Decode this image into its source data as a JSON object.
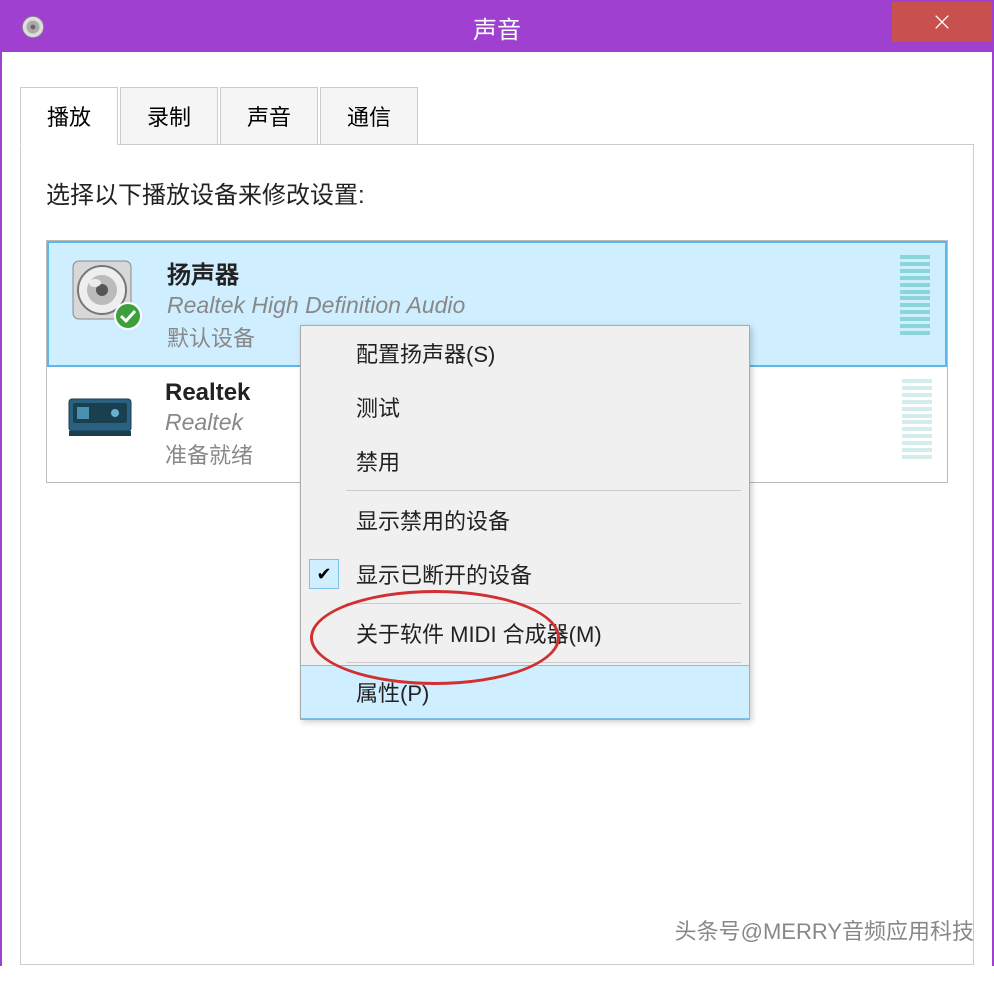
{
  "window": {
    "title": "声音"
  },
  "tabs": [
    {
      "label": "播放",
      "active": true
    },
    {
      "label": "录制",
      "active": false
    },
    {
      "label": "声音",
      "active": false
    },
    {
      "label": "通信",
      "active": false
    }
  ],
  "instruction": "选择以下播放设备来修改设置:",
  "devices": [
    {
      "name": "扬声器",
      "subtitle": "Realtek High Definition Audio",
      "status": "默认设备",
      "selected": true,
      "default": true,
      "icon": "speaker"
    },
    {
      "name": "Realtek",
      "subtitle": "Realtek",
      "status": "准备就绪",
      "selected": false,
      "default": false,
      "icon": "digital"
    }
  ],
  "context_menu": {
    "items": [
      {
        "label": "配置扬声器(S)",
        "checked": false
      },
      {
        "label": "测试",
        "checked": false
      },
      {
        "label": "禁用",
        "checked": false
      },
      {
        "divider": true
      },
      {
        "label": "显示禁用的设备",
        "checked": false
      },
      {
        "label": "显示已断开的设备",
        "checked": true
      },
      {
        "divider": true
      },
      {
        "label": "关于软件 MIDI 合成器(M)",
        "checked": false
      },
      {
        "divider": true
      },
      {
        "label": "属性(P)",
        "checked": false,
        "highlighted": true
      }
    ]
  },
  "watermark": "头条号@MERRY音频应用科技"
}
